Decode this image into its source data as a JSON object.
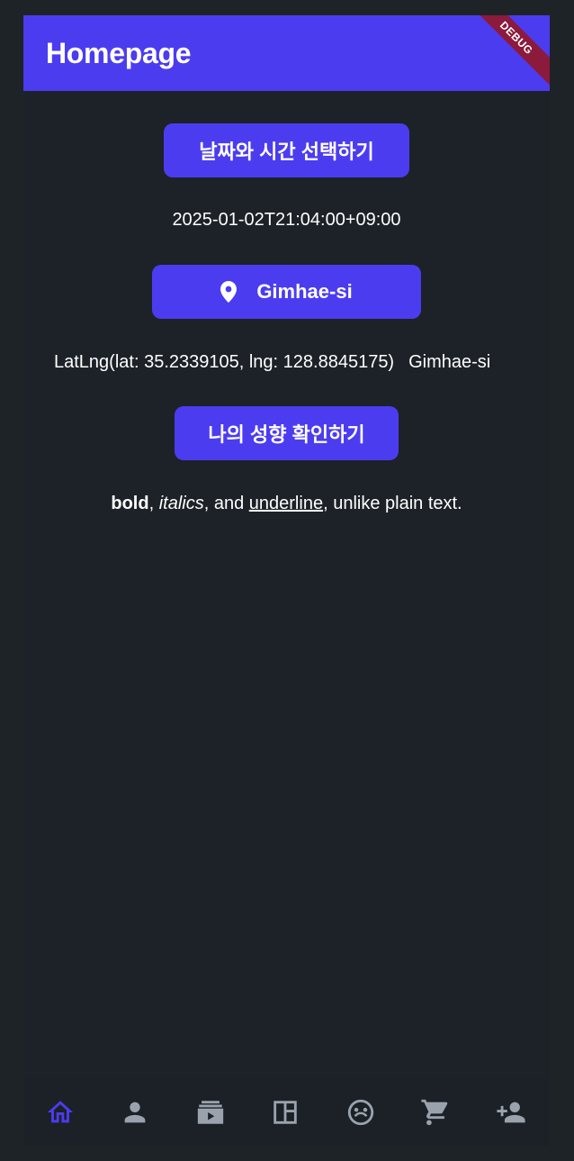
{
  "app": {
    "title": "Homepage",
    "debug_badge": "DEBUG"
  },
  "buttons": {
    "datetime_label": "날짜와 시간 선택하기",
    "location_label": "Gimhae-si",
    "personality_label": "나의 성향 확인하기"
  },
  "datetime_value": "2025-01-02T21:04:00+09:00",
  "location": {
    "latlng_text": "LatLng(lat: 35.2339105, lng: 128.8845175)",
    "city": "Gimhae-si"
  },
  "rich_text": {
    "bold": "bold",
    "sep1": ", ",
    "italic": "italics",
    "sep2": ", and ",
    "underline": "underline",
    "rest": ", unlike plain text."
  },
  "nav": {
    "items": [
      {
        "icon": "home-icon",
        "active": true
      },
      {
        "icon": "person-icon",
        "active": false
      },
      {
        "icon": "video-library-icon",
        "active": false
      },
      {
        "icon": "dashboard-icon",
        "active": false
      },
      {
        "icon": "face-emoji-icon",
        "active": false
      },
      {
        "icon": "shopping-cart-icon",
        "active": false
      },
      {
        "icon": "person-add-icon",
        "active": false
      }
    ],
    "active_color": "#4c3cf0",
    "inactive_color": "#9aa3ad"
  },
  "colors": {
    "accent": "#4c3cf0",
    "background": "#1e2328",
    "debug_ribbon": "#8b1a3c"
  }
}
